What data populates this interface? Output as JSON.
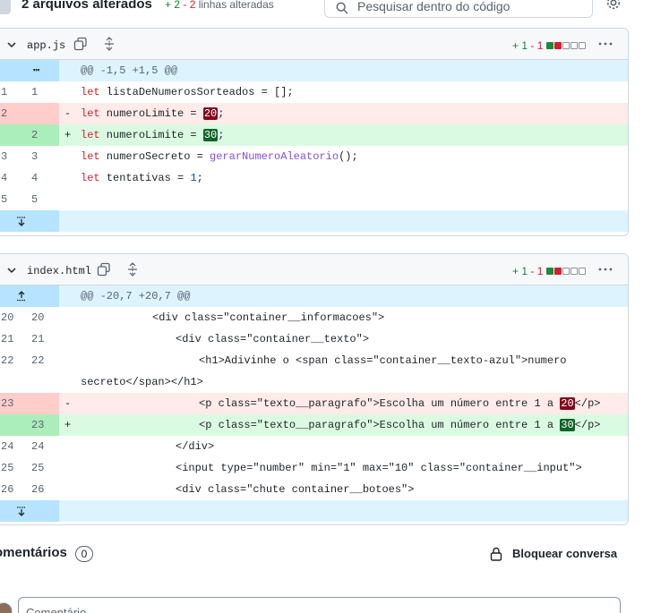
{
  "header": {
    "title": "2 arquivos alterados",
    "additions": "+ 2",
    "deletions": "- 2",
    "changed_label": "linhas alteradas",
    "search_placeholder": "Pesquisar dentro do código"
  },
  "files": [
    {
      "name": "app.js",
      "additions": "+ 1",
      "deletions": "- 1",
      "hunk": "@@ -1,5 +1,5 @@",
      "expand_label": "⋯"
    },
    {
      "name": "index.html",
      "additions": "+ 1",
      "deletions": "- 1",
      "hunk": "@@ -20,7 +20,7 @@"
    }
  ],
  "file1_lines": {
    "l1": {
      "a": "1",
      "b": "1"
    },
    "l2": {
      "a": "2"
    },
    "l3": {
      "b": "2"
    },
    "l4": {
      "a": "3",
      "b": "3"
    },
    "l5": {
      "a": "4",
      "b": "4"
    },
    "l6": {
      "a": "5",
      "b": "5"
    }
  },
  "file2_lines": {
    "l1": {
      "a": "20",
      "b": "20"
    },
    "l2": {
      "a": "21",
      "b": "21"
    },
    "l3": {
      "a": "22",
      "b": "22"
    },
    "l5": {
      "a": "23"
    },
    "l6": {
      "b": "23"
    },
    "l7": {
      "a": "24",
      "b": "24"
    },
    "l8": {
      "a": "25",
      "b": "25"
    },
    "l9": {
      "a": "26",
      "b": "26"
    }
  },
  "code": {
    "let": "let",
    "minus": "-",
    "plus": "+",
    "f1_l1_name": " listaDeNumerosSorteados = [];",
    "f1_name_limite": " numeroLimite = ",
    "f1_old_val": "20",
    "f1_new_val": "30",
    "semicolon": ";",
    "f1_l4_a": " numeroSecreto = ",
    "f1_l4_fn": "gerarNumeroAleatorio",
    "f1_l4_b": "();",
    "f1_l5_a": " tentativas = ",
    "f1_l5_num": "1",
    "f2_l1": "<div class=\"container__informacoes\">",
    "f2_l2": "<div class=\"container__texto\">",
    "f2_l3": "<h1>Adivinhe o <span class=\"container__texto-azul\">numero",
    "f2_l4": "secreto</span></h1>",
    "f2_l5_a": "<p class=\"texto__paragrafo\">Escolha um número entre 1 a ",
    "f2_old_val": "20",
    "f2_new_val": "30",
    "f2_l5_b": "</p>",
    "f2_l7": "</div>",
    "f2_l8": "<input type=\"number\" min=\"1\" max=\"10\" class=\"container__input\">",
    "f2_l9": "<div class=\"chute container__botoes\">"
  },
  "comments": {
    "title": "omentários",
    "count": "0",
    "lock_label": "Bloquear conversa",
    "placeholder": "Comentário"
  },
  "colors": {
    "addition": "#1a7f37",
    "deletion": "#cf222e",
    "hunk_bg": "#ddf4ff"
  }
}
